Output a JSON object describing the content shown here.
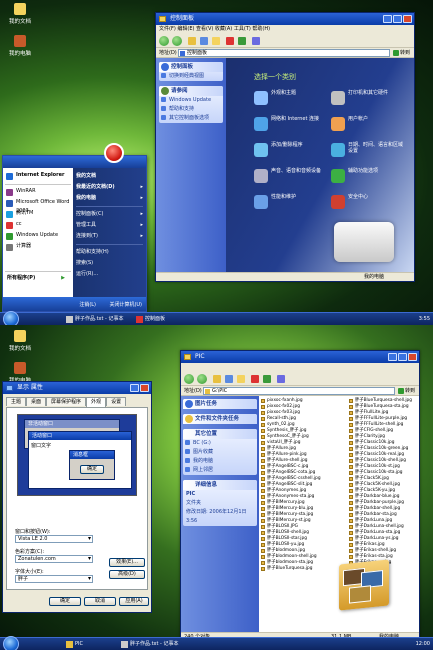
{
  "top": {
    "desktop_icons": [
      {
        "label": "我的文档"
      },
      {
        "label": "我的电脑"
      }
    ],
    "controlpanel": {
      "title": "控制面板",
      "menu": "文件(F)  编辑(E)  查看(V)  收藏(A)  工具(T)  帮助(H)",
      "address_label": "地址(D)",
      "address_value": "控制面板",
      "go_label": "转到",
      "pane_head": "控制面板",
      "switch_view": "切换到经典视图",
      "see_also_head": "请参阅",
      "see_also": [
        "Windows Update",
        "帮助和支持",
        "其它控制面板选项"
      ],
      "heading": "选择一个类别",
      "categories": [
        {
          "label": "外观和主题",
          "color": "#8fc0ff"
        },
        {
          "label": "打印机和其它硬件",
          "color": "#c0c0c0"
        },
        {
          "label": "网络和 Internet 连接",
          "color": "#4fa3e8"
        },
        {
          "label": "用户帐户",
          "color": "#f0a050"
        },
        {
          "label": "添加/删除程序",
          "color": "#6fc2f0"
        },
        {
          "label": "日期、时间、语言和区域设置",
          "color": "#4ab0e0"
        },
        {
          "label": "声音、语音和音频设备",
          "color": "#b0b0c8"
        },
        {
          "label": "辅助功能选项",
          "color": "#3cb043"
        },
        {
          "label": "性能和维护",
          "color": "#6aa0e8"
        },
        {
          "label": "安全中心",
          "color": "#d04030"
        }
      ],
      "status": "我的电脑"
    },
    "startmenu": {
      "left_items": [
        {
          "label": "Internet Explorer",
          "bold": true,
          "color": "#1d6ad6"
        },
        {
          "label": "WinRAR",
          "bold": false,
          "color": "#8a3a8a"
        },
        {
          "label": "Microsoft Office Word 2003",
          "bold": false,
          "color": "#2a5bb8"
        },
        {
          "label": "腾讯TM",
          "bold": false,
          "color": "#1aa0e0"
        },
        {
          "label": "cc",
          "bold": false,
          "color": "#d33"
        },
        {
          "label": "Windows Update",
          "bold": false,
          "color": "#2f9a2f"
        },
        {
          "label": "计算器",
          "bold": false,
          "color": "#777"
        }
      ],
      "all_programs": "所有程序(P)",
      "right_items": [
        {
          "label": "我的文档",
          "bold": true,
          "arrow": ""
        },
        {
          "label": "我最近的文档(D)",
          "bold": true,
          "arrow": "▸"
        },
        {
          "label": "我的电脑",
          "bold": true,
          "arrow": "▸"
        },
        {
          "label": "控制面板(C)",
          "bold": false,
          "arrow": "▸"
        },
        {
          "label": "管理工具",
          "bold": false,
          "arrow": "▸"
        },
        {
          "label": "连接到(T)",
          "bold": false,
          "arrow": "▸"
        },
        {
          "label": "帮助和支持(H)",
          "bold": false,
          "arrow": ""
        },
        {
          "label": "搜索(S)",
          "bold": false,
          "arrow": ""
        },
        {
          "label": "运行(R)...",
          "bold": false,
          "arrow": ""
        }
      ],
      "logoff": "注销(L)",
      "shutdown": "关闭计算机(U)"
    },
    "taskbar": {
      "items": [
        {
          "label": "胖子作品.txt - 记事本"
        },
        {
          "label": "控制面板"
        }
      ],
      "clock": "3:55"
    }
  },
  "bottom": {
    "desktop_icons": [
      {
        "label": "我的文档"
      },
      {
        "label": "我的电脑"
      }
    ],
    "dialog": {
      "title": "显示 属性",
      "tabs": [
        "主题",
        "桌面",
        "屏幕保护程序",
        "外观",
        "设置"
      ],
      "active_tab": "外观",
      "preview_inactive": "非活动窗口",
      "preview_active": "活动窗口",
      "preview_text": "窗口文字",
      "preview_msgbox": "消息框",
      "preview_ok": "确定",
      "style_label": "窗口和按钮(W):",
      "style_value": "Vista LE 2.0",
      "scheme_label": "色彩方案(C):",
      "scheme_value": "Zonatulen.com",
      "font_label": "字体大小(E):",
      "font_value": "胖子",
      "effects_btn": "效果(E)...",
      "advanced_btn": "高级(D)",
      "ok": "确定",
      "cancel": "取消",
      "apply": "应用(A)"
    },
    "explorer": {
      "title": "PIC",
      "address_label": "地址(D)",
      "address_value": "G:\\PIC",
      "go_label": "转到",
      "tasks_head": "图片任务",
      "file_tasks_head": "文件和文件夹任务",
      "other_head": "其它位置",
      "other_items": [
        "BC (G:)",
        "图片收藏",
        "我的电脑",
        "网上邻居"
      ],
      "details_head": "详细信息",
      "details_lines": [
        "PIC",
        "文件夹",
        "修改日期: 2006年12月1日",
        "3:56"
      ],
      "col1": [
        "pixxoc-fxanh.jpg",
        "pixxoc-fx02.jpg",
        "pixxoc-fx03.jpg",
        "Recall-sth.jpg",
        "synth_02.jpg",
        "Synthesis_胖子.jpg",
        "SynthesoC_胖子.jpg",
        "vistaUI_胖子.jpg",
        "胖子Allure.jpg",
        "胖子Allure-pink.jpg",
        "胖子Allure-shell.jpg",
        "胖子AngelBSC-c.jpg",
        "胖子AngelBSC-cota.jpg",
        "胖子AngelBSC-csshell.jpg",
        "胖子AngelBSC-slit.jpg",
        "胖子Anonymes.jpg",
        "胖子Anonymes-sta.jpg",
        "胖子BlMercury.jpg",
        "胖子BlMercury-blu.jpg",
        "胖子BlMercury-sta.jpg",
        "胖子BlMercury-st.jpg",
        "胖子BLOSII.JPG",
        "胖子BLOSII-shell.jpg",
        "胖子BLOSII-star.jpg",
        "胖子BLOSII-yu.jpg",
        "胖子blodmoon.jpg",
        "胖子blodmoon-shell.jpg",
        "胖子blodmoon-sta.jpg",
        "胖子BlueTurquesa.jpg"
      ],
      "col2": [
        "胖子BlueTurquesa-shell.jpg",
        "胖子BlueTurquesa-sta.jpg",
        "胖子FlullLite.jpg",
        "胖子FFFullLite-purple.jpg",
        "胖子FFFullLite-shell.jpg",
        "胖子CFlG-shell.jpg",
        "胖子Clarity.jpg",
        "胖子Classic10k.jpg",
        "胖子Classic10k-green.jpg",
        "胖子Classic10k-real.jpg",
        "胖子Classic10k-shell.jpg",
        "胖子Classic10k-st.jpg",
        "胖子Classic10k-sta.jpg",
        "胖子Clack5K.jpg",
        "胖子Clack5K-shell.jpg",
        "胖子Clack5K-yu.jpg",
        "胖子Darkbar-blue.jpg",
        "胖子Darkbar-purple.jpg",
        "胖子Darkbar-shell.jpg",
        "胖子Darkbar-sta.jpg",
        "胖子DarkLuna.jpg",
        "胖子DarkLuna-shell.jpg",
        "胖子DarkLuna-sta.jpg",
        "胖子DarkLuna-ys.jpg",
        "胖子Erikas.jpg",
        "胖子Erikas-shell.jpg",
        "胖子Erikas-sta.jpg",
        "胖子Erikas-yu.jpg"
      ],
      "status_left": "240 个对象",
      "status_mid": "31.1 MB",
      "status_right": "我的电脑"
    },
    "taskbar": {
      "items": [
        {
          "label": "PIC"
        },
        {
          "label": "胖子作品.txt - 记事本"
        }
      ],
      "clock": "12:00"
    }
  }
}
